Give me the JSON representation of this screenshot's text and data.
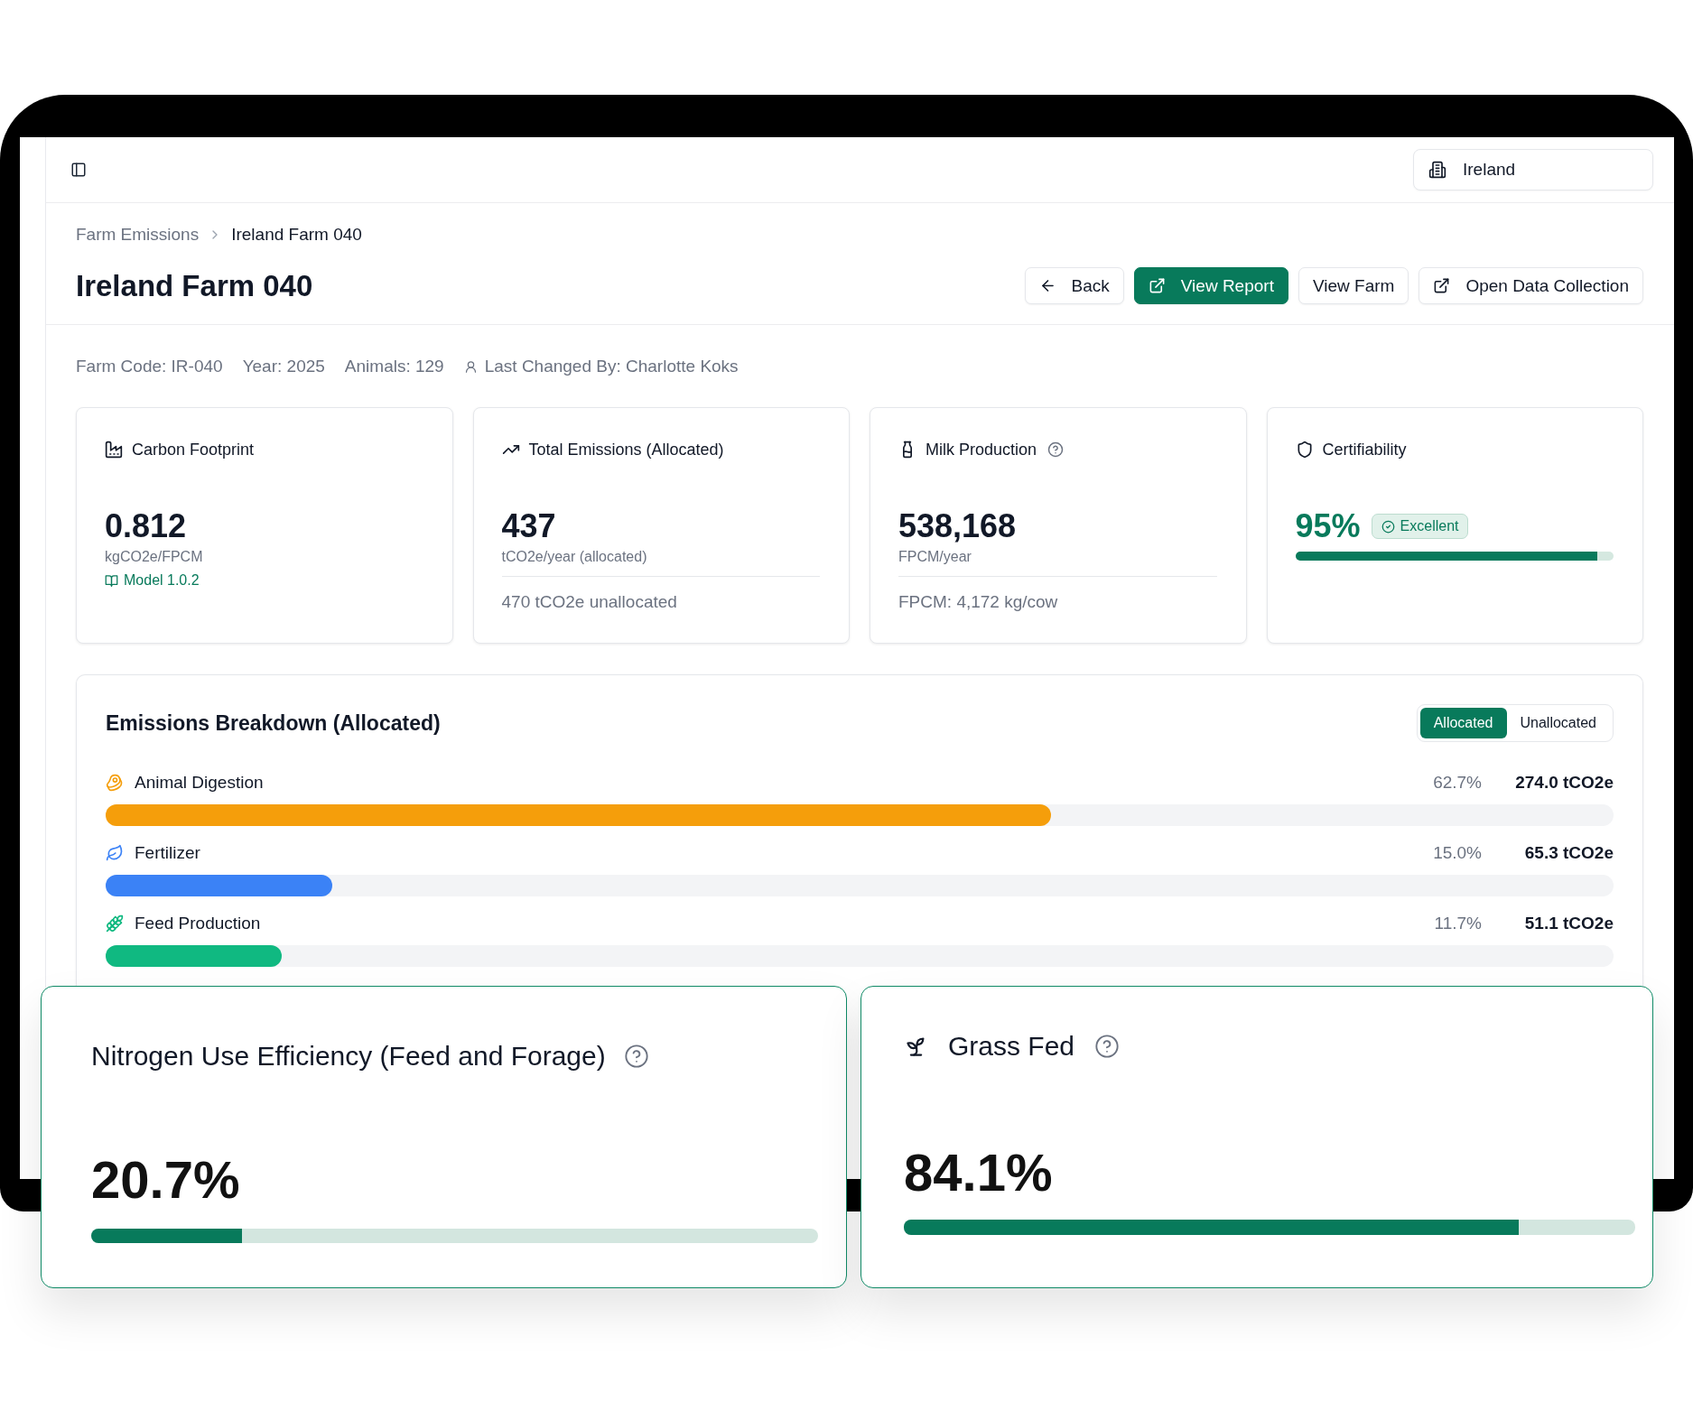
{
  "top_bar": {
    "region": "Ireland"
  },
  "breadcrumb": [
    {
      "label": "Farm Emissions",
      "current": false
    },
    {
      "label": "Ireland Farm 040",
      "current": true
    }
  ],
  "header": {
    "title": "Ireland Farm 040",
    "actions": [
      {
        "kind": "back",
        "label": "Back"
      },
      {
        "kind": "primary",
        "label": "View Report"
      },
      {
        "kind": "plain",
        "label": "View Farm"
      },
      {
        "kind": "external",
        "label": "Open Data Collection"
      }
    ]
  },
  "meta": [
    {
      "kind": "plain",
      "text": "Farm Code: IR-040"
    },
    {
      "kind": "plain",
      "text": "Year: 2025"
    },
    {
      "kind": "plain",
      "text": "Animals: 129"
    },
    {
      "kind": "user",
      "text": "Last Changed By: Charlotte Koks"
    }
  ],
  "metric_cards": [
    {
      "kind": "carbon",
      "title": "Carbon Footprint",
      "help": false,
      "value": "0.812",
      "unit": "kgCO2e/FPCM",
      "link": "Model 1.0.2"
    },
    {
      "kind": "emissions",
      "title": "Total Emissions (Allocated)",
      "help": false,
      "value": "437",
      "unit": "tCO2e/year (allocated)",
      "note": "470 tCO2e unallocated"
    },
    {
      "kind": "milk",
      "title": "Milk Production",
      "help": true,
      "value": "538,168",
      "unit": "FPCM/year",
      "note": "FPCM: 4,172 kg/cow"
    },
    {
      "kind": "certifiability",
      "title": "Certifiability",
      "help": false,
      "value": "95%",
      "badge": "Excellent",
      "level": 0.95
    }
  ],
  "breakdown": {
    "title": "Emissions Breakdown (Allocated)",
    "modes": [
      {
        "label": "Allocated",
        "selected": true
      },
      {
        "label": "Unallocated",
        "selected": false
      }
    ],
    "rows": [
      {
        "kind": "digestion",
        "label": "Animal Digestion",
        "share": "62.7%",
        "amount": "274.0 tCO2e",
        "level": 0.627,
        "color": "#f59e0b"
      },
      {
        "kind": "fertilizer",
        "label": "Fertilizer",
        "share": "15.0%",
        "amount": "65.3 tCO2e",
        "level": 0.15,
        "color": "#3b82f6"
      },
      {
        "kind": "feed",
        "label": "Feed Production",
        "share": "11.7%",
        "amount": "51.1 tCO2e",
        "level": 0.117,
        "color": "#10b981"
      }
    ]
  },
  "highlight_cards": [
    {
      "kind": "nue",
      "title": "Nitrogen Use Efficiency (Feed and Forage)",
      "help": true,
      "value": "20.7%",
      "level": 0.207
    },
    {
      "kind": "grass",
      "title": "Grass Fed",
      "help": true,
      "value": "84.1%",
      "level": 0.841
    }
  ]
}
